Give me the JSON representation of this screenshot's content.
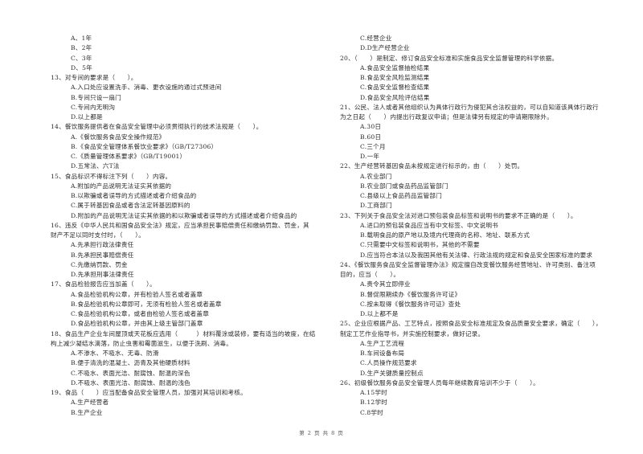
{
  "left_column": {
    "q12_options": [
      "A、1年",
      "B、2年",
      "C、3年",
      "D、5年"
    ],
    "questions": [
      {
        "stem": [
          "13、对专间的要求是（　　）。"
        ],
        "options": [
          "A.入口处应设置洗手、消毒、更衣设施的通过式预进间",
          "B.专间只设一扇门",
          "C.专间内无明沟",
          "D.以上都是"
        ]
      },
      {
        "stem": [
          "14、餐饮服务提供者在食品安全管理中必须贯彻执行的技术法规是（　　）。"
        ],
        "options": [
          "A.《餐饮服务食品安全操作规范》",
          "B.《食品安全管理体系餐饮业要求》（GB/T27306）",
          "C.《质量管理体系要求》（GB/T19001）",
          "D.五常法、六T法"
        ]
      },
      {
        "stem": [
          "15、食品标识不得标注下列（　　）内容。"
        ],
        "options": [
          "A.附加的产品说明无法证实其依据的",
          "B.以欺骗或者误导的方式描述或者介绍食品的",
          "C.属于转基因食品或者含法定转基因原料的",
          "D.附加的产品说明无法证实其依据的和以欺骗或者误导的方式描述或者介绍食品的"
        ]
      },
      {
        "stem": [
          "16、违反《中华人民共和国食品安全法》规定，应当承担民事赔偿责任和缴纳罚款、罚金，其",
          "财产不足以同时支付时，（　　）。"
        ],
        "options": [
          "A.先承担行政法律责任",
          "B.先承担民事赔偿责任",
          "C.先缴纳罚款、罚金",
          "D.先承担刑事法律责任"
        ]
      },
      {
        "stem": [
          "17、食品检验报告应当加盖（　　）。"
        ],
        "options": [
          "A.食品检验机构公章，并有检验人签名或者盖章",
          "B.食品检验机构公章即可，无须有检验人签名或者盖章",
          "C.食品检验机构公章，或者由检验人签名或者盖章",
          "D.食品检验机构公章，并由其上级主管部门盖章"
        ]
      },
      {
        "stem": [
          "18、食品生产企业车间屋顶或天花板应选用（　　　）材料覆涂或装修，要有适当的坡度，在结",
          "构上减少凝结水滴落，防止虫害和霉菌滋生，以便于洗刷、消毒。"
        ],
        "options": [
          "A.不渗水、不吸水、无毒、防滑",
          "B.便于清洗的混凝土、沥青及其他硬质材料",
          "C.不吸水、表面光洁、耐腐蚀、耐温的深色",
          "D.不吸水、表面光洁、耐腐蚀、耐温的浅色"
        ]
      },
      {
        "stem": [
          "19、食品（　　）应当配备食品安全管理人员，加强对其培训和考核。"
        ],
        "options": [
          "A.生产经营者",
          "B.生产企业"
        ]
      }
    ]
  },
  "right_column": {
    "q19_options": [
      "C.经营企业",
      "D.D生产经营企业"
    ],
    "questions": [
      {
        "stem": [
          "20、（　　）是制定、修订食品安全标准和实施食品安全监督管理的科学依据。"
        ],
        "options": [
          "A.食品安全监督抽检结果",
          "B.食品安全风险监测结果",
          "C.食品安全监督检查结果",
          "D.食品安全风险评估结果"
        ]
      },
      {
        "stem": [
          "21、公民、法人或者其他组织认为具体行政行为侵犯其合法权益的，可以自知道该具体行政行",
          "为之日起（　　）内提出行政复议申请；但是法律另有规定的申请期限除外。"
        ],
        "options": [
          "A.30日",
          "B.60日",
          "C.三个月",
          "D.一年"
        ]
      },
      {
        "stem": [
          "22、生产经营转基因食品未按规定进行标示的，由（　　）处罚。"
        ],
        "options": [
          "A.农业部门",
          "B.农业部门或食品药品监管部门",
          "C.县级以上食品药品监管部门",
          "D.工商部门"
        ]
      },
      {
        "stem": [
          "23、下列关于食品安全法对进口预包装食品标签和说明书的要求不正确的是（　　）。"
        ],
        "options": [
          "A.进口的预包装食品应当有中文标签、中文说明书",
          "B.载明食品的原产地以及境内代理商的名称、地址、联系方式",
          "C.只需要中文标签和说明书，其他的不需要",
          "D.应当符合本法以及我国其他有关法律、行政法规的规定和食品安全国家标准的要求"
        ]
      },
      {
        "stem": [
          "24、《餐饮服务食品安全监督管理办法》规定擅自改变餐饮服务经营地址、许可类别、备注项",
          "目的，应当（　　）。"
        ],
        "options": [
          "A.责令其立即停业",
          "B.督促限期续办《餐饮服务许可证》",
          "C.按未取得《餐饮服务许可证》查处",
          "D.以上都不是"
        ]
      },
      {
        "stem": [
          "25、企业应根据产品、工艺特点，按照食品安全标准规定及食品质量安全要求，确定（　　），",
          "制定工艺作业指导书，并实施控制要求，做好记录。"
        ],
        "options": [
          "A.生产工艺流程",
          "B.车间设备布局",
          "C.人员操作规范要求",
          "D.生产关键质量控制点"
        ]
      },
      {
        "stem": [
          "26、初级餐饮服务食品安全管理人员每年继续教育培训不少于（　　）。"
        ],
        "options": [
          "A.15学时",
          "B.12学时",
          "C.8学时"
        ]
      }
    ]
  },
  "footer": {
    "page_label": "第 2 页 共 8 页"
  }
}
